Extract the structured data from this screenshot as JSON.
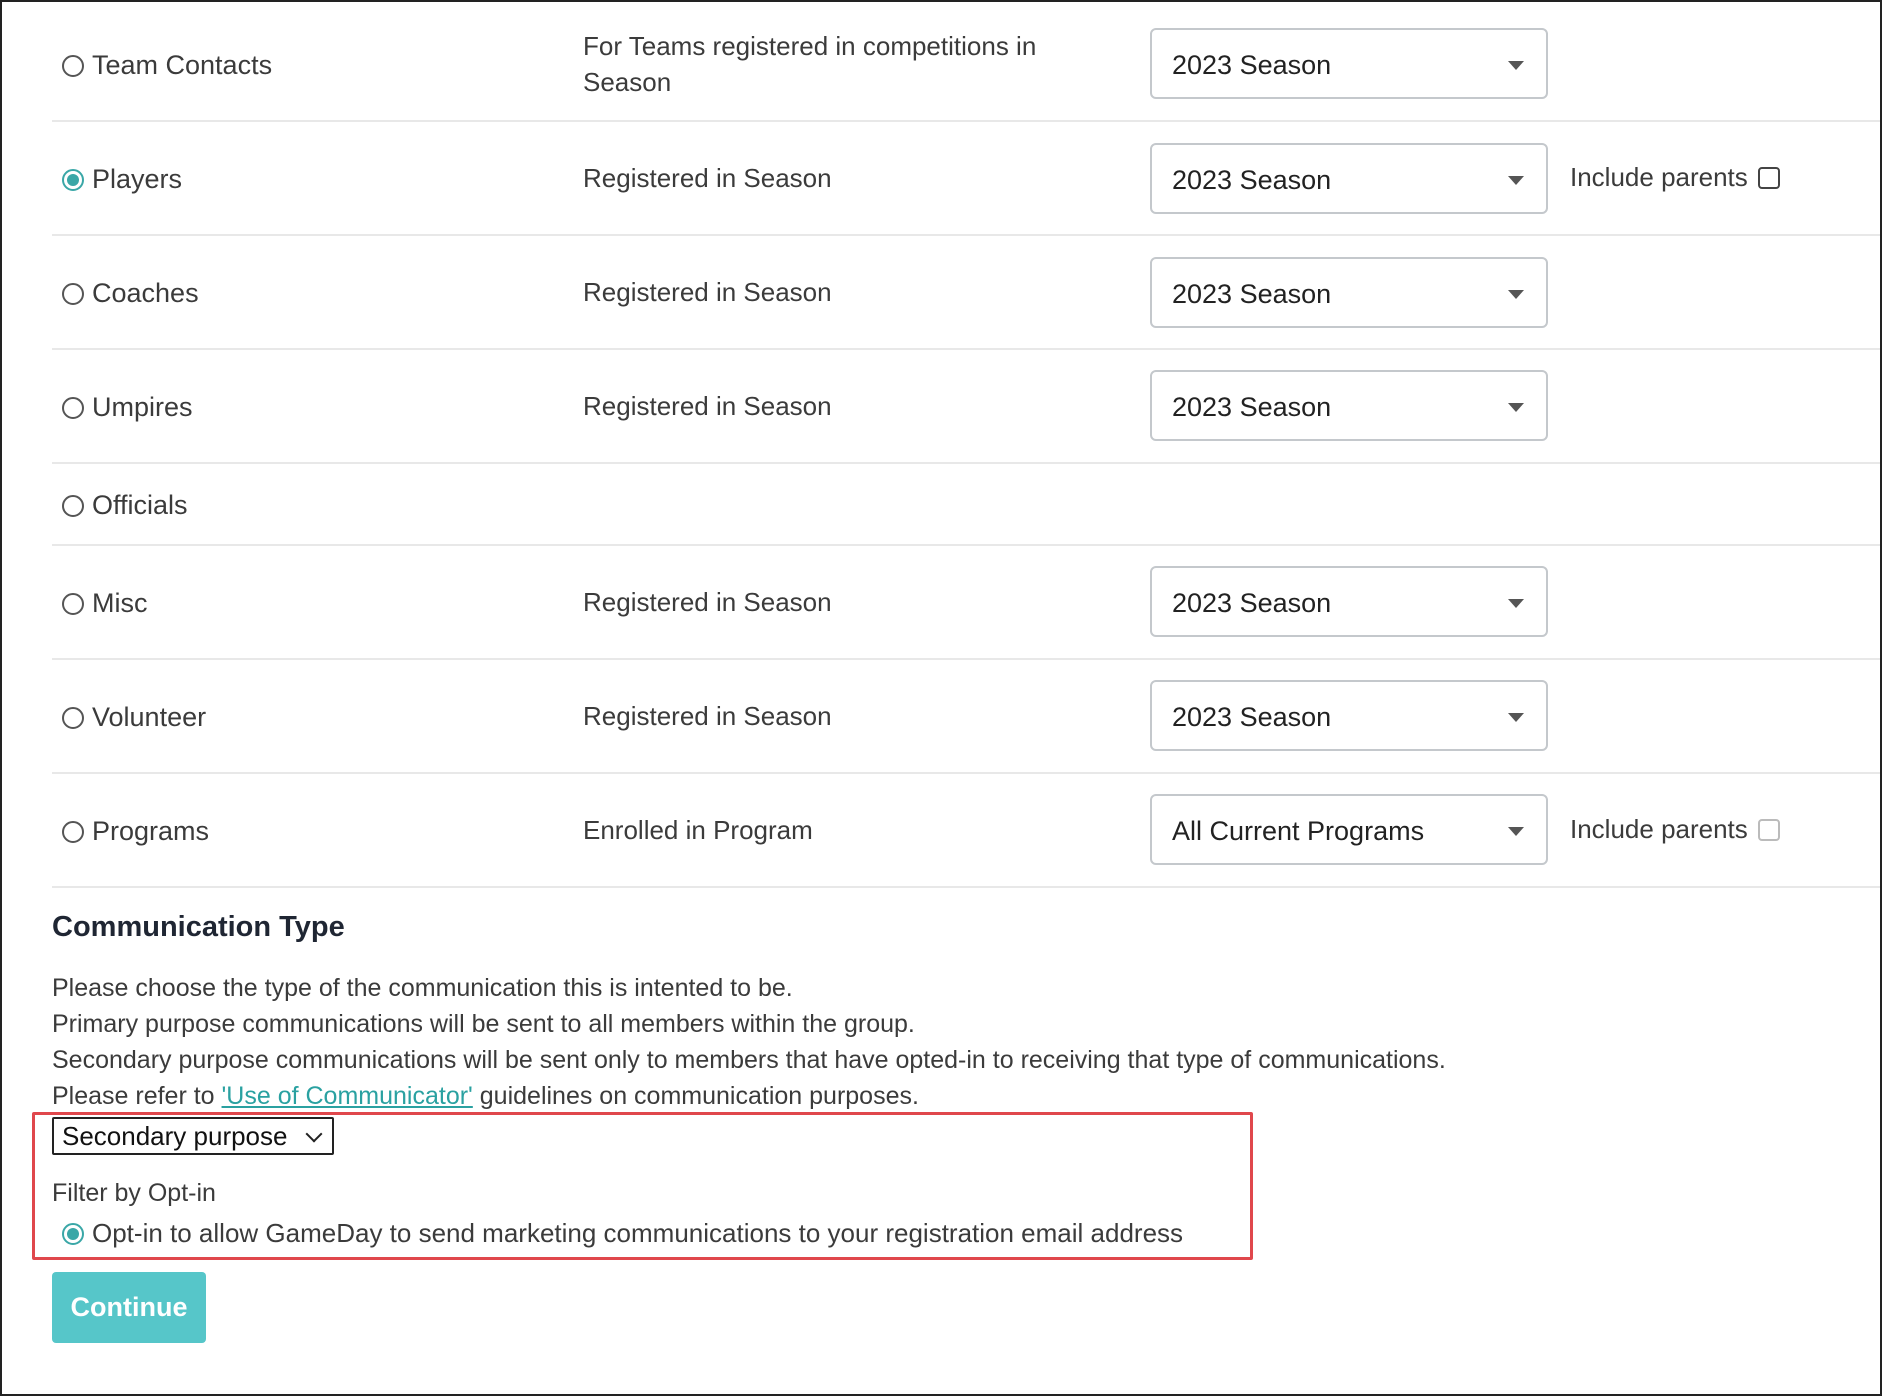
{
  "recipients": [
    {
      "label": "Team Contacts",
      "desc_lines": [
        "For Teams registered in competitions in",
        "Season"
      ],
      "select": "2023 Season",
      "checked": false,
      "include_parents": null
    },
    {
      "label": "Players",
      "desc_lines": [
        "Registered in Season"
      ],
      "select": "2023 Season",
      "checked": true,
      "include_parents": "Include parents"
    },
    {
      "label": "Coaches",
      "desc_lines": [
        "Registered in Season"
      ],
      "select": "2023 Season",
      "checked": false,
      "include_parents": null
    },
    {
      "label": "Umpires",
      "desc_lines": [
        "Registered in Season"
      ],
      "select": "2023 Season",
      "checked": false,
      "include_parents": null
    },
    {
      "label": "Officials",
      "desc_lines": [],
      "select": null,
      "checked": false,
      "include_parents": null
    },
    {
      "label": "Misc",
      "desc_lines": [
        "Registered in Season"
      ],
      "select": "2023 Season",
      "checked": false,
      "include_parents": null
    },
    {
      "label": "Volunteer",
      "desc_lines": [
        "Registered in Season"
      ],
      "select": "2023 Season",
      "checked": false,
      "include_parents": null
    },
    {
      "label": "Programs",
      "desc_lines": [
        "Enrolled in Program"
      ],
      "select": "All Current Programs",
      "checked": false,
      "include_parents": "Include parents"
    }
  ],
  "communication": {
    "title": "Communication Type",
    "line1": "Please choose the type of the communication this is intented to be.",
    "line2": "Primary purpose communications will be sent to all members within the group.",
    "line3": "Secondary purpose communications will be sent only to members that have opted-in to receiving that type of communications.",
    "line4_pre": "Please refer to ",
    "line4_link": "'Use of Communicator'",
    "line4_post": " guidelines on communication purposes.",
    "select_value": "Secondary purpose",
    "filter_label": "Filter by Opt-in",
    "optin_label": "Opt-in to allow GameDay to send marketing communications to your registration email address"
  },
  "continue_label": "Continue",
  "colors": {
    "accent": "#3aa7a7",
    "button": "#56c6c9",
    "highlight": "#e0474c"
  }
}
